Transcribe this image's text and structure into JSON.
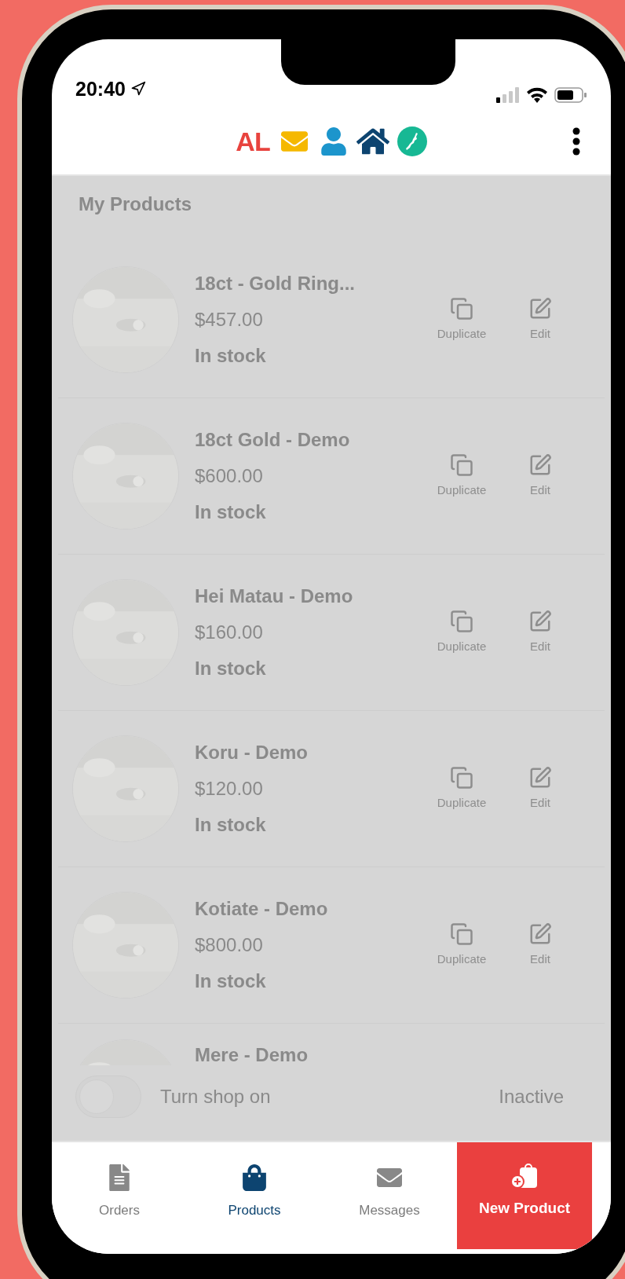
{
  "status_bar": {
    "time": "20:40"
  },
  "header": {
    "logo": "AL"
  },
  "page_title": "My Products",
  "products": [
    {
      "name": "18ct - Gold Ring...",
      "price": "$457.00",
      "stock": "In stock",
      "duplicate": "Duplicate",
      "edit": "Edit"
    },
    {
      "name": "18ct Gold - Demo",
      "price": "$600.00",
      "stock": "In stock",
      "duplicate": "Duplicate",
      "edit": "Edit"
    },
    {
      "name": "Hei Matau - Demo",
      "price": "$160.00",
      "stock": "In stock",
      "duplicate": "Duplicate",
      "edit": "Edit"
    },
    {
      "name": "Koru - Demo",
      "price": "$120.00",
      "stock": "In stock",
      "duplicate": "Duplicate",
      "edit": "Edit"
    },
    {
      "name": "Kotiate - Demo",
      "price": "$800.00",
      "stock": "In stock",
      "duplicate": "Duplicate",
      "edit": "Edit"
    },
    {
      "name": "Mere - Demo"
    }
  ],
  "shop_toggle": {
    "label": "Turn shop on",
    "status": "Inactive",
    "on": false
  },
  "nav": [
    {
      "kind": "orders",
      "label": "Orders",
      "selected": false
    },
    {
      "kind": "products",
      "label": "Products",
      "selected": true
    },
    {
      "kind": "messages",
      "label": "Messages",
      "selected": false
    }
  ],
  "new_product_button": "New Product"
}
